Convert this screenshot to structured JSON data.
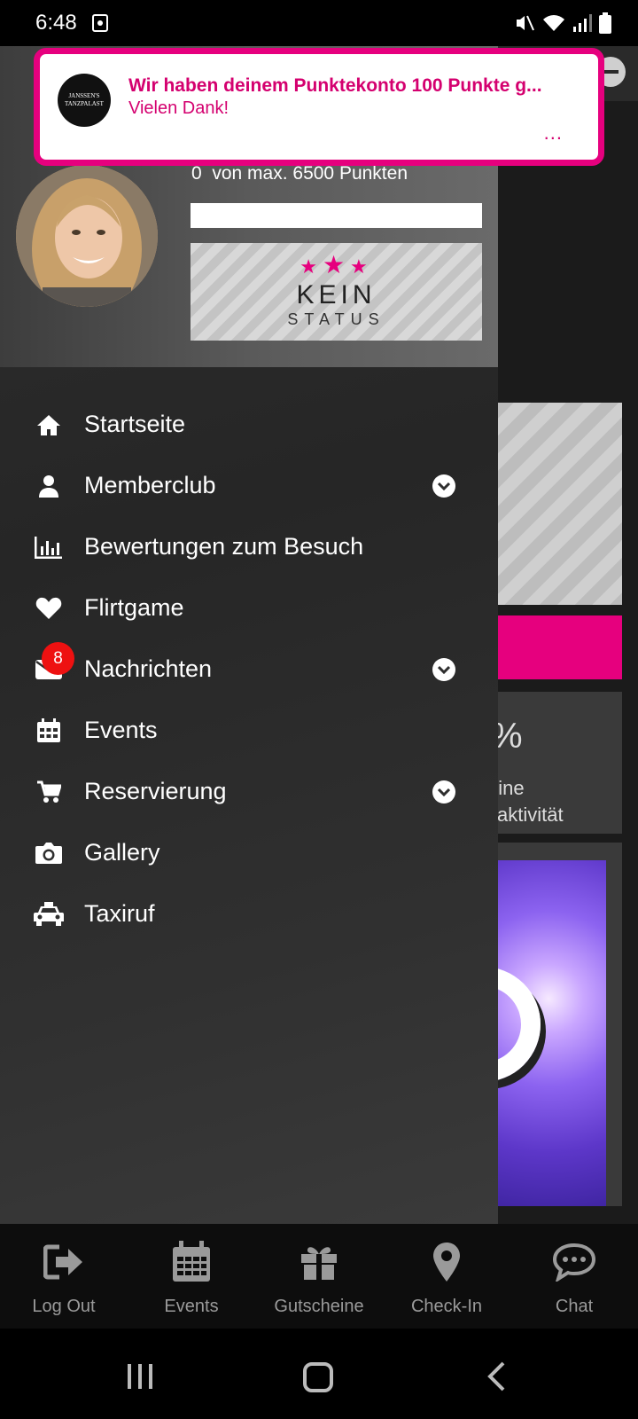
{
  "status_bar": {
    "time": "6:48"
  },
  "notification": {
    "app_logo_text": "JANSSEN'S TANZPALAST",
    "title": "Wir haben deinem Punktekonto 100 Punkte g...",
    "body": "Vielen Dank!",
    "more": "..."
  },
  "profile": {
    "points_value": "0",
    "points_text": "von max. 6500 Punkten",
    "points_progress": 0,
    "status_card": {
      "line1": "KEIN",
      "line2": "STATUS"
    }
  },
  "menu": {
    "items": [
      {
        "label": "Startseite",
        "icon": "home-icon",
        "expandable": false
      },
      {
        "label": "Memberclub",
        "icon": "user-icon",
        "expandable": true
      },
      {
        "label": "Bewertungen zum Besuch",
        "icon": "bar-chart-icon",
        "expandable": false
      },
      {
        "label": "Flirtgame",
        "icon": "heart-icon",
        "expandable": false
      },
      {
        "label": "Nachrichten",
        "icon": "envelope-icon",
        "expandable": true,
        "badge": "8"
      },
      {
        "label": "Events",
        "icon": "calendar-icon",
        "expandable": false
      },
      {
        "label": "Reservierung",
        "icon": "cart-icon",
        "expandable": true
      },
      {
        "label": "Gallery",
        "icon": "camera-icon",
        "expandable": false
      },
      {
        "label": "Taxiruf",
        "icon": "taxi-icon",
        "expandable": false
      }
    ]
  },
  "background": {
    "activity_percent": "%",
    "activity_line1": "eine",
    "activity_line2": "saktivität"
  },
  "bottom_nav": {
    "items": [
      {
        "label": "Log Out",
        "icon": "logout-icon"
      },
      {
        "label": "Events",
        "icon": "calendar-icon"
      },
      {
        "label": "Gutscheine",
        "icon": "gift-icon"
      },
      {
        "label": "Check-In",
        "icon": "map-pin-icon"
      },
      {
        "label": "Chat",
        "icon": "chat-icon"
      }
    ]
  },
  "colors": {
    "accent": "#e6007e",
    "badge": "#ee1111",
    "drawer": "#2e2e2e"
  }
}
